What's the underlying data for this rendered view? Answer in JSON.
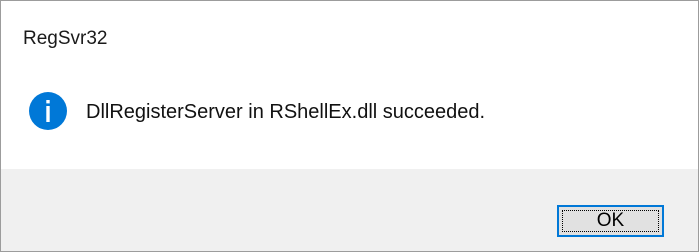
{
  "window": {
    "title": "RegSvr32"
  },
  "message": {
    "text": "DllRegisterServer in RShellEx.dll succeeded.",
    "icon": "information-icon",
    "icon_color": "#0078d7"
  },
  "buttons": {
    "ok_label": "OK"
  },
  "colors": {
    "footer_background": "#f0f0f0",
    "button_border": "#0078d7"
  }
}
